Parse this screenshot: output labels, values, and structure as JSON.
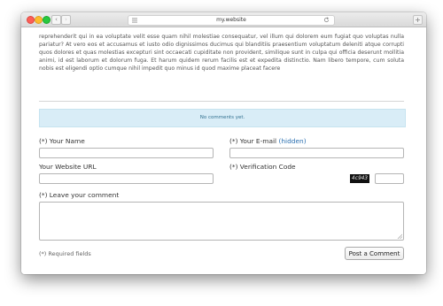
{
  "browser": {
    "url": "my.website",
    "back_label": "‹",
    "forward_label": "›",
    "newtab_label": "+"
  },
  "article": {
    "text": "reprehenderit qui in ea voluptate velit esse quam nihil molestiae consequatur, vel illum qui dolorem eum fugiat quo voluptas nulla pariatur? At vero eos et accusamus et iusto odio dignissimos ducimus qui blanditiis praesentium voluptatum deleniti atque corrupti quos dolores et quas molestias excepturi sint occaecati cupiditate non provident, similique sunt in culpa qui officia deserunt mollitia animi, id est laborum et dolorum fuga. Et harum quidem rerum facilis est et expedita distinctio. Nam libero tempore, cum soluta nobis est eligendi optio cumque nihil impedit quo minus id quod maxime placeat facere"
  },
  "comments": {
    "empty_text": "No comments yet."
  },
  "form": {
    "name_label": "(*) Your Name",
    "email_label": "(*) Your E-mail",
    "email_hidden": "(hidden)",
    "url_label": "Your Website URL",
    "verification_label": "(*) Verification Code",
    "captcha_text": "4c943",
    "comment_label": "(*) Leave your comment",
    "required_note": "(*) Required fields",
    "submit_label": "Post a Comment"
  }
}
